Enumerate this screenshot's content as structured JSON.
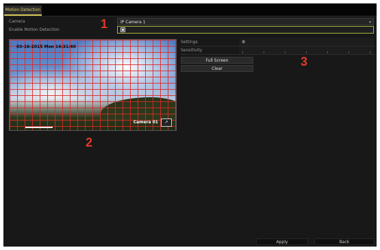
{
  "tabs": [
    {
      "label": "Motion Detection"
    }
  ],
  "form": {
    "camera_label": "Camera",
    "camera_value": "IP Camera 1",
    "enable_label": "Enable Motion Detection",
    "enable_value": "☑ ↗"
  },
  "callouts": {
    "one": "1",
    "two": "2",
    "three": "3"
  },
  "preview": {
    "timestamp": "03-16-2015 Mon 14:31:40",
    "camera_name": "Camera 01",
    "icon": "↗"
  },
  "settings": {
    "rows": [
      {
        "key": "Settings",
        "value": "⚙"
      },
      {
        "key": "Sensitivity",
        "value": ""
      }
    ]
  },
  "actions": {
    "full_screen": "Full Screen",
    "clear": "Clear"
  },
  "footer": {
    "apply": "Apply",
    "back": "Back"
  },
  "colors": {
    "accent": "#d7c95a",
    "grid": "#dc2828",
    "callout": "#e03a28",
    "background": "#181818"
  }
}
